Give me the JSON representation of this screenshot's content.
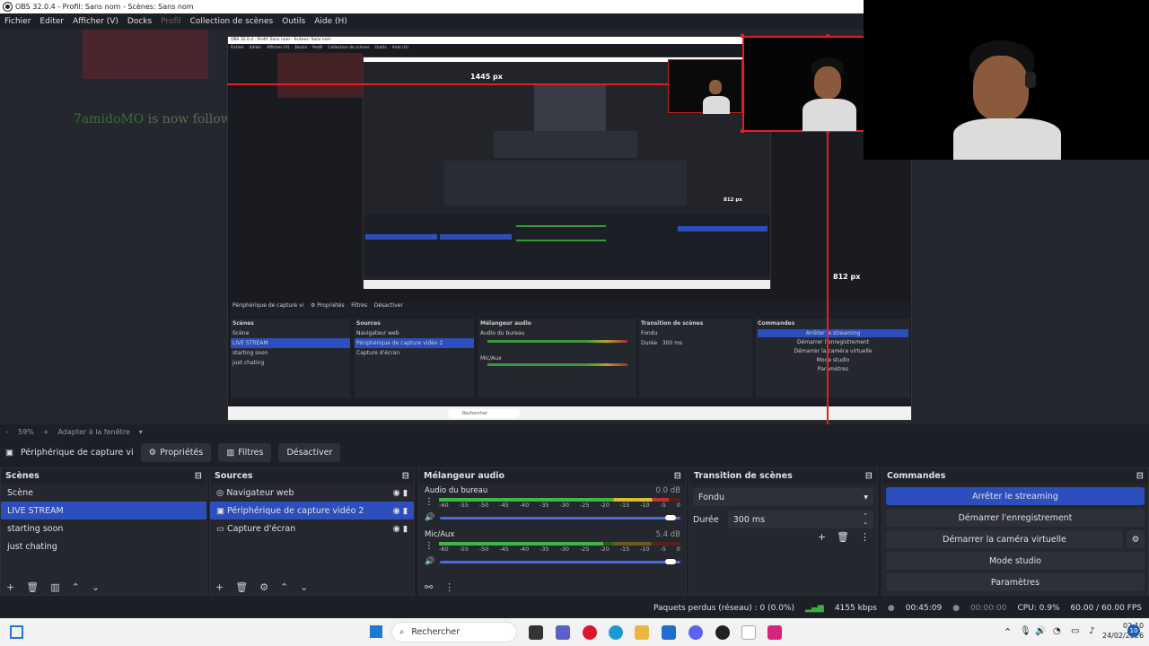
{
  "window": {
    "title": "OBS 32.0.4 - Profil: Sans nom - Scènes: Sans nom"
  },
  "menu": [
    "Fichier",
    "Editer",
    "Afficher (V)",
    "Docks",
    "Profil",
    "Collection de scènes",
    "Outils",
    "Aide (H)"
  ],
  "preview": {
    "follow_name": "7amidoMO",
    "follow_text": " is now following!",
    "label_width": "1445 px",
    "label_height_small": "812 px",
    "label_height": "812 px"
  },
  "zoom": {
    "value": "59%",
    "mode": "Adapter à la fenêtre"
  },
  "source_bar": {
    "source_name": "Périphérique de capture vi",
    "properties": "Propriétés",
    "filters": "Filtres",
    "deactivate": "Désactiver"
  },
  "scenes": {
    "title": "Scènes",
    "items": [
      "Scène",
      "LIVE STREAM",
      "starting soon",
      "just chating"
    ],
    "selected": 1
  },
  "sources": {
    "title": "Sources",
    "items": [
      {
        "label": "Navigateur web",
        "icon": "globe-icon"
      },
      {
        "label": "Périphérique de capture vidéo 2",
        "icon": "camera-icon"
      },
      {
        "label": "Capture d'écran",
        "icon": "monitor-icon"
      }
    ],
    "selected": 1
  },
  "mixer": {
    "title": "Mélangeur audio",
    "tracks": [
      {
        "name": "Audio du bureau",
        "db": "0.0 dB",
        "level": 0.95,
        "volume": 0.98
      },
      {
        "name": "Mic/Aux",
        "db": "5.4 dB",
        "level": 0.68,
        "volume": 0.98
      }
    ],
    "ticks": [
      "-60",
      "-55",
      "-50",
      "-45",
      "-40",
      "-35",
      "-30",
      "-25",
      "-20",
      "-15",
      "-10",
      "-5",
      "0"
    ]
  },
  "transition": {
    "title": "Transition de scènes",
    "type": "Fondu",
    "duration_label": "Durée",
    "duration": "300 ms"
  },
  "commands": {
    "title": "Commandes",
    "buttons": [
      "Arrêter le streaming",
      "Démarrer l'enregistrement",
      "Démarrer la caméra virtuelle",
      "Mode studio",
      "Paramètres"
    ]
  },
  "status": {
    "dropped": "Paquets perdus (réseau) : 0 (0.0%)",
    "bitrate": "4155 kbps",
    "live_time": "00:45:09",
    "rec_time": "00:00:00",
    "cpu": "CPU: 0.9%",
    "fps": "60.00 / 60.00 FPS"
  },
  "taskbar": {
    "search": "Rechercher",
    "time": "02:10",
    "date": "24/02/2026",
    "notif": "10"
  },
  "colors": {
    "accent": "#2c4fbd",
    "red_guide": "#e02020"
  }
}
